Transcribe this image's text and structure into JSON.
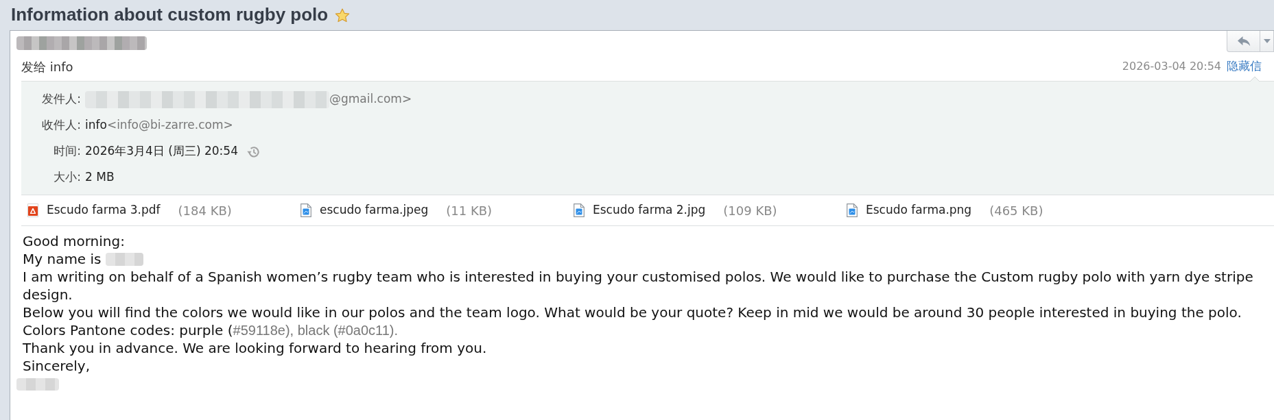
{
  "subject": {
    "text": "Information about custom rugby polo",
    "starred": true
  },
  "header": {
    "sender_items": [
      {
        "kind": "redacted"
      }
    ],
    "toolbar": [
      {
        "kind": "reply"
      },
      {
        "kind": "more"
      }
    ],
    "recipient_summary": "发给 info",
    "date": "2026-03-04 20:54",
    "toggle_link": "隐藏信"
  },
  "details": [
    {
      "label": "发件人:",
      "items": [
        {
          "kind": "redacted"
        },
        {
          "kind": "text",
          "runs": [
            {
              "text": "@gmail.com>",
              "muted": true
            }
          ]
        }
      ]
    },
    {
      "label": "收件人:",
      "items": [
        {
          "kind": "text",
          "runs": [
            {
              "text": "info",
              "muted": false
            },
            {
              "text": "<info@bi-zarre.com>",
              "muted": true
            }
          ]
        }
      ]
    },
    {
      "label": "时间:",
      "items": [
        {
          "kind": "text",
          "runs": [
            {
              "text": "2026年3月4日 (周三) 20:54",
              "muted": false
            }
          ]
        },
        {
          "kind": "history"
        }
      ]
    },
    {
      "label": "大小:",
      "items": [
        {
          "kind": "text",
          "runs": [
            {
              "text": "2 MB",
              "muted": false
            }
          ]
        }
      ]
    }
  ],
  "attachments": [
    {
      "kind": "pdf",
      "name": "Escudo farma 3.pdf",
      "size": "(184 KB)"
    },
    {
      "kind": "image",
      "name": "escudo farma.jpeg",
      "size": "(11 KB)"
    },
    {
      "kind": "image",
      "name": "Escudo farma 2.jpg",
      "size": "(109 KB)"
    },
    {
      "kind": "image",
      "name": "Escudo farma.png",
      "size": "(465 KB)"
    }
  ],
  "body": [
    {
      "items": [
        {
          "kind": "text",
          "runs": [
            {
              "text": "Good morning:",
              "muted": false
            }
          ]
        }
      ]
    },
    {
      "items": [
        {
          "kind": "text",
          "runs": [
            {
              "text": "My name is",
              "muted": false
            }
          ]
        },
        {
          "kind": "redacted"
        }
      ]
    },
    {
      "items": [
        {
          "kind": "text",
          "runs": [
            {
              "text": "I am writing on behalf of a Spanish women’s rugby team who is interested in buying your customised polos. We would like to purchase the Custom rugby polo with yarn dye stripe design.",
              "muted": false
            }
          ]
        }
      ]
    },
    {
      "items": [
        {
          "kind": "text",
          "runs": [
            {
              "text": "Below you will find the colors we would like in our polos and the team logo. What would be your quote? Keep in mid we would be around 30 people interested in buying the polo.",
              "muted": false
            }
          ]
        }
      ]
    },
    {
      "items": [
        {
          "kind": "text",
          "runs": [
            {
              "text": "Colors Pantone codes: purple (",
              "muted": false
            },
            {
              "text": "#59118e), black (#0a0c11).",
              "muted": true
            }
          ]
        }
      ]
    },
    {
      "items": [
        {
          "kind": "text",
          "runs": [
            {
              "text": "Thank you in advance. We are looking forward to hearing from you.",
              "muted": false
            }
          ]
        }
      ]
    },
    {
      "items": [
        {
          "kind": "text",
          "runs": [
            {
              "text": "Sincerely,",
              "muted": false
            }
          ]
        }
      ]
    },
    {
      "items": [
        {
          "kind": "redacted"
        }
      ]
    }
  ]
}
